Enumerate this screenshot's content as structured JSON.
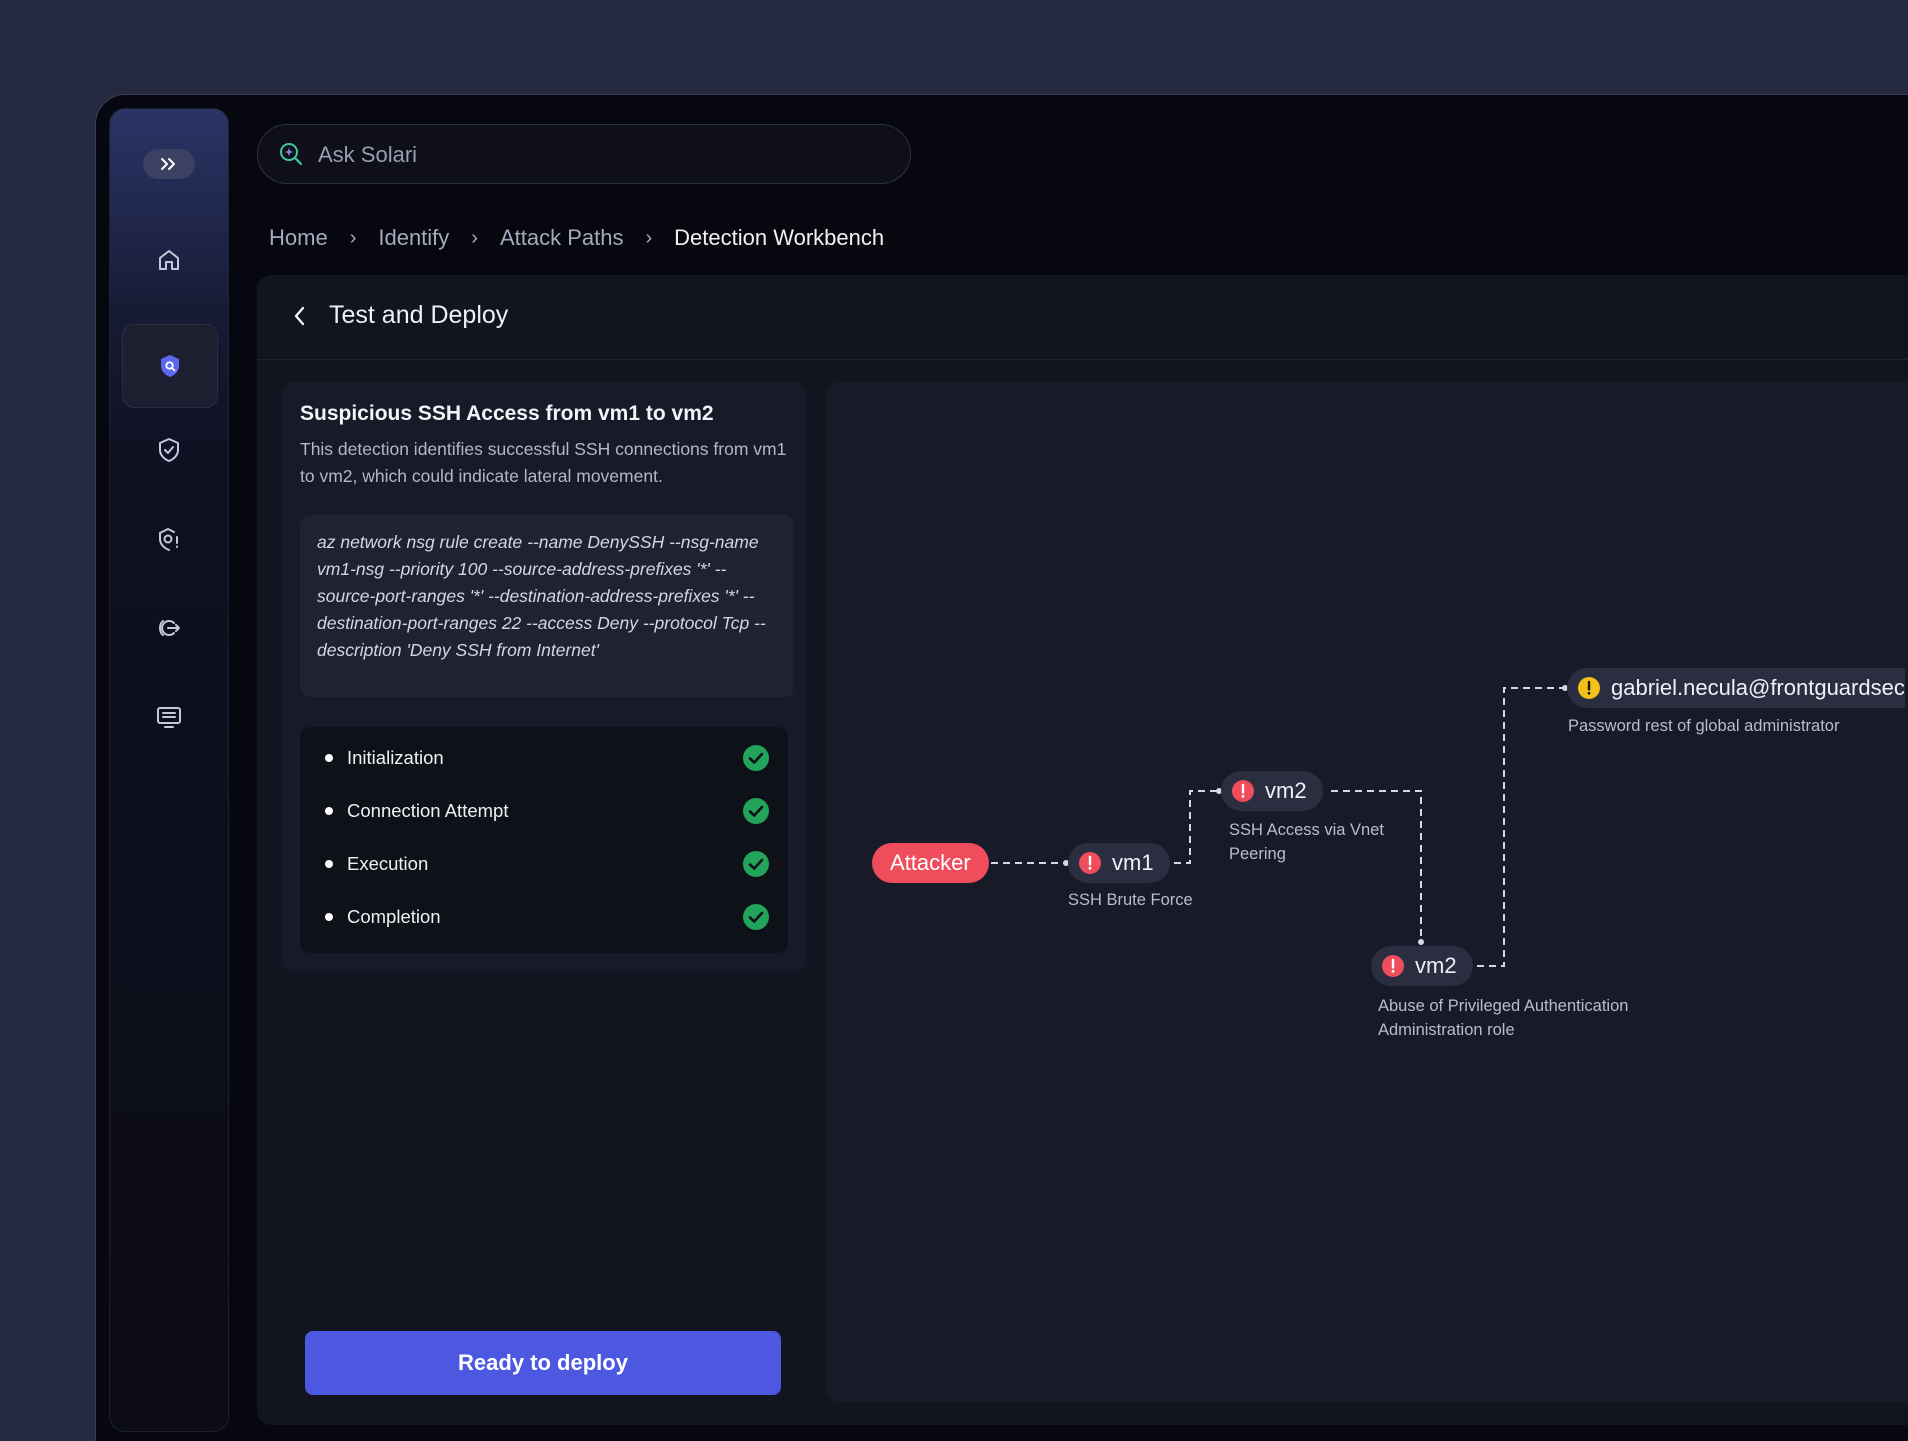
{
  "search": {
    "placeholder": "Ask Solari"
  },
  "breadcrumb": [
    "Home",
    "Identify",
    "Attack Paths",
    "Detection Workbench"
  ],
  "panel": {
    "title": "Test and Deploy"
  },
  "detection": {
    "title": "Suspicious SSH Access from vm1 to vm2",
    "description": "This detection identifies successful SSH connections from vm1 to vm2, which could indicate lateral movement.",
    "command": "az network nsg rule create --name DenySSH --nsg-name vm1-nsg --priority 100 --source-address-prefixes '*' --source-port-ranges '*' --destination-address-prefixes '*' --destination-port-ranges 22 --access Deny --protocol Tcp --description 'Deny SSH from Internet'"
  },
  "steps": [
    {
      "label": "Initialization",
      "status": "complete"
    },
    {
      "label": "Connection Attempt",
      "status": "complete"
    },
    {
      "label": "Execution",
      "status": "complete"
    },
    {
      "label": "Completion",
      "status": "complete"
    }
  ],
  "deploy_button": "Ready to deploy",
  "sidebar": {
    "items": [
      {
        "icon": "home-icon"
      },
      {
        "icon": "shield-search-icon",
        "active": true
      },
      {
        "icon": "shield-check-icon"
      },
      {
        "icon": "shield-alert-icon"
      },
      {
        "icon": "logout-icon"
      },
      {
        "icon": "monitor-list-icon"
      }
    ]
  },
  "attack_path": {
    "nodes": [
      {
        "id": "attacker",
        "label": "Attacker",
        "severity": "attacker",
        "caption": ""
      },
      {
        "id": "vm1",
        "label": "vm1",
        "severity": "critical",
        "caption": "SSH Brute Force"
      },
      {
        "id": "vm2-a",
        "label": "vm2",
        "severity": "critical",
        "caption": "SSH Access via Vnet Peering"
      },
      {
        "id": "vm2-b",
        "label": "vm2",
        "severity": "critical",
        "caption": "Abuse of Privileged Authentication Administration role"
      },
      {
        "id": "user",
        "label": "gabriel.necula@frontguardsec",
        "severity": "warning",
        "caption": "Password rest of global administrator"
      }
    ],
    "edges": [
      [
        "attacker",
        "vm1"
      ],
      [
        "vm1",
        "vm2-a"
      ],
      [
        "vm2-a",
        "vm2-b"
      ],
      [
        "vm2-b",
        "user"
      ]
    ]
  },
  "colors": {
    "accent": "#4c58e0",
    "critical": "#ef4d5c",
    "warning": "#f2c21b",
    "success": "#22a55a"
  }
}
